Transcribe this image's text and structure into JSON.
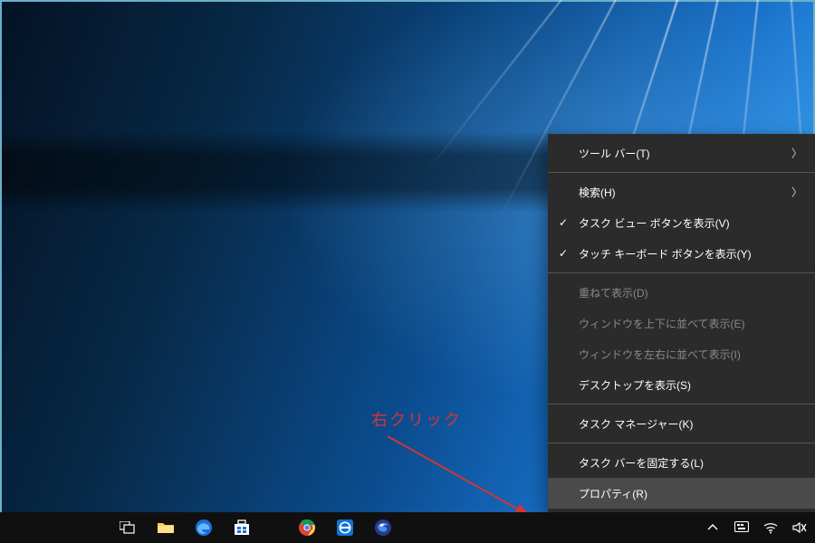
{
  "annotation": {
    "label": "右クリック"
  },
  "context_menu": {
    "items": [
      {
        "label": "ツール バー(T)",
        "type": "submenu"
      },
      {
        "label": "検索(H)",
        "type": "submenu"
      },
      {
        "label": "タスク ビュー ボタンを表示(V)",
        "type": "check"
      },
      {
        "label": "タッチ キーボード ボタンを表示(Y)",
        "type": "check"
      },
      {
        "label": "重ねて表示(D)",
        "type": "disabled"
      },
      {
        "label": "ウィンドウを上下に並べて表示(E)",
        "type": "disabled"
      },
      {
        "label": "ウィンドウを左右に並べて表示(I)",
        "type": "disabled"
      },
      {
        "label": "デスクトップを表示(S)",
        "type": "normal"
      },
      {
        "label": "タスク マネージャー(K)",
        "type": "normal"
      },
      {
        "label": "タスク バーを固定する(L)",
        "type": "normal"
      },
      {
        "label": "プロパティ(R)",
        "type": "hover"
      }
    ]
  },
  "taskbar": {
    "icons": {
      "taskview": "task-view-icon",
      "explorer": "file-explorer-icon",
      "edge": "edge-icon",
      "store": "store-icon",
      "chrome": "chrome-icon",
      "teamviewer": "teamviewer-icon",
      "thunderbird": "thunderbird-icon"
    },
    "tray": {
      "up": "show-hidden-icons",
      "ime": "ime-icon",
      "wifi": "wifi-icon",
      "volume": "volume-icon"
    }
  },
  "colors": {
    "annotation": "#d43434",
    "highlight": "#e01818",
    "menu_bg": "#2b2b2b",
    "menu_hover": "#4a4a4a",
    "taskbar": "#101010"
  }
}
